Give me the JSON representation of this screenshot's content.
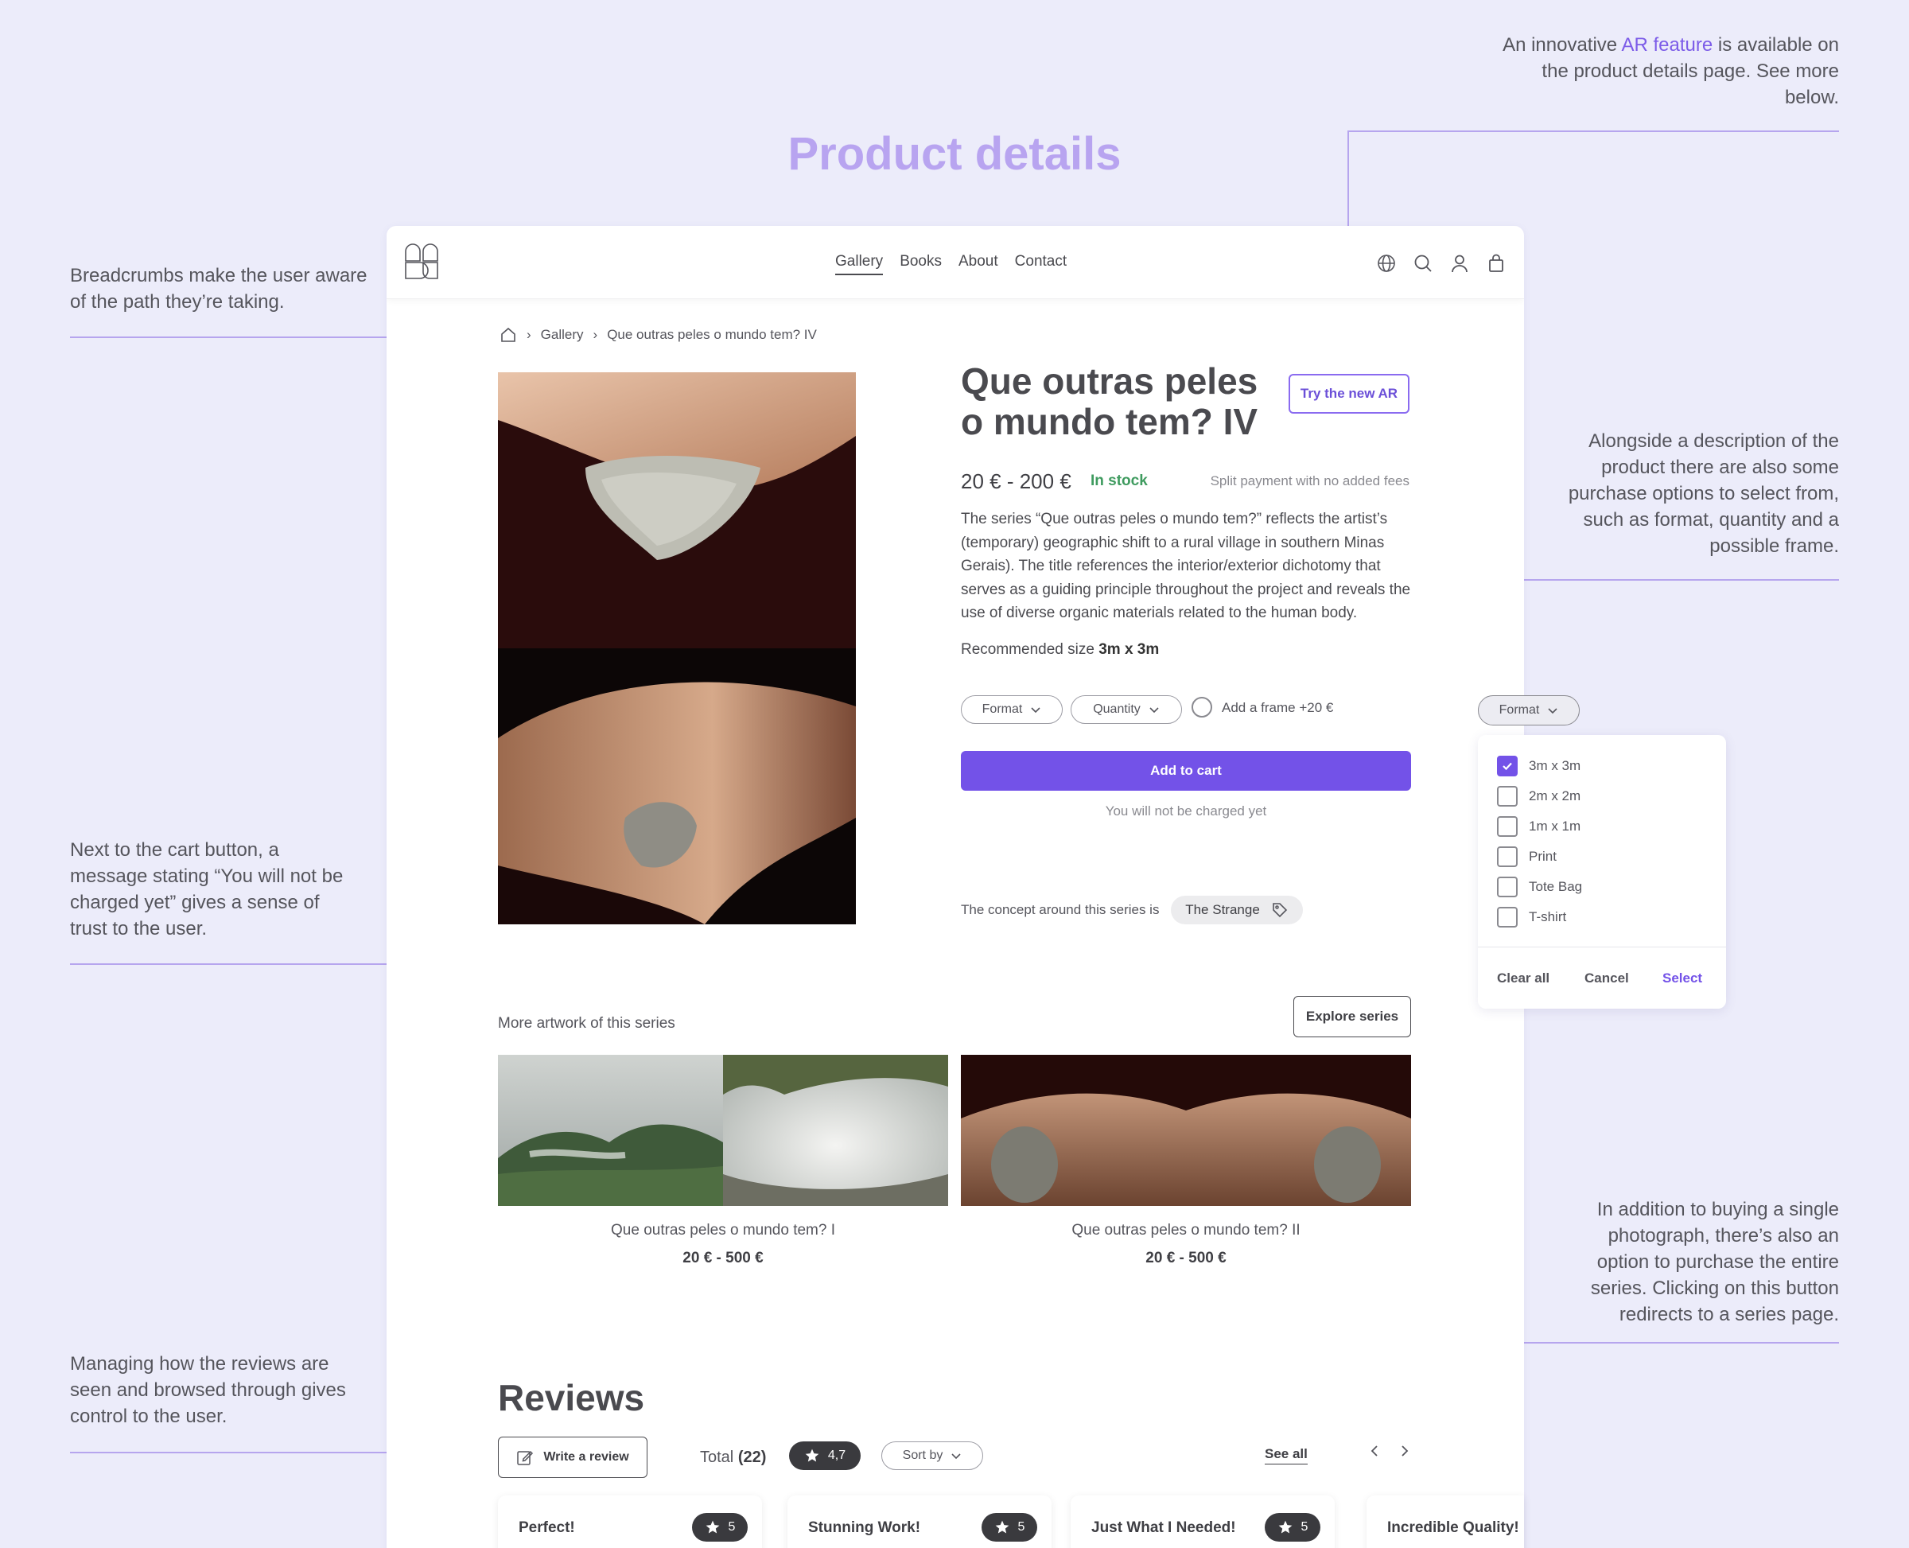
{
  "page_title": "Product details",
  "annotations": {
    "ar": {
      "before": "An innovative ",
      "accent": "AR feature",
      "after": " is available on the product details page. See more below."
    },
    "breadcrumbs": "Breadcrumbs make the user aware of the path they’re taking.",
    "description": "Alongside a  description of the product there are also some purchase options to select from, such as format, quantity and a possible frame.",
    "cart": "Next to the cart button, a message stating “You will not be charged yet” gives a sense of trust to the user.",
    "series": "In addition to buying a single photograph, there’s also an option to purchase the entire series. Clicking on this button redirects to a series page.",
    "reviews": "Managing how the reviews are seen and browsed through gives control to the user."
  },
  "nav": {
    "items": [
      "Gallery",
      "Books",
      "About",
      "Contact"
    ],
    "active": "Gallery"
  },
  "icons": [
    "globe-icon",
    "search-icon",
    "user-icon",
    "bag-icon"
  ],
  "breadcrumb": {
    "items": [
      "Gallery",
      "Que outras peles o mundo tem? IV"
    ]
  },
  "product": {
    "title": "Que outras peles o mundo tem? IV",
    "ar_button": "Try the new AR",
    "price": "20 € - 200 €",
    "stock": "In stock",
    "split": "Split payment with no added fees",
    "description": "The series “Que outras peles o mundo tem?” reflects the artist’s (temporary) geographic shift to a rural village in southern Minas Gerais). The title references the interior/exterior dichotomy that serves as a guiding principle throughout the project and reveals the use of diverse organic materials related to the human body.",
    "rec_label": "Recommended size ",
    "rec_value": "3m x 3m",
    "format_label": "Format",
    "quantity_label": "Quantity",
    "frame_label": "Add a frame +20 €",
    "cart_button": "Add to cart",
    "not_charged": "You will not be charged yet",
    "concept_label": "The concept around this series is",
    "concept_tag": "The Strange"
  },
  "series": {
    "heading": "More artwork of this series",
    "explore_button": "Explore series",
    "items": [
      {
        "title": "Que outras peles o mundo tem? I",
        "price": "20 € - 500 €"
      },
      {
        "title": "Que outras peles o mundo tem? II",
        "price": "20 € - 500 €"
      }
    ]
  },
  "reviews": {
    "heading": "Reviews",
    "write_button": "Write a review",
    "total_label": "Total ",
    "total_count": "(22)",
    "avg_rating": "4,7",
    "sort_label": "Sort by",
    "see_all": "See all",
    "cards": [
      {
        "title": "Perfect!",
        "rating": "5"
      },
      {
        "title": "Stunning Work!",
        "rating": "5"
      },
      {
        "title": "Just What I Needed!",
        "rating": "5"
      },
      {
        "title": "Incredible Quality!"
      }
    ]
  },
  "format_dropdown": {
    "label": "Format",
    "options": [
      {
        "label": "3m x 3m",
        "checked": true
      },
      {
        "label": "2m x 2m",
        "checked": false
      },
      {
        "label": "1m x 1m",
        "checked": false
      },
      {
        "label": "Print",
        "checked": false
      },
      {
        "label": "Tote Bag",
        "checked": false
      },
      {
        "label": "T-shirt",
        "checked": false
      }
    ],
    "clear_all": "Clear all",
    "cancel": "Cancel",
    "select": "Select"
  },
  "colors": {
    "accent": "#7352e8",
    "background": "#ececfa",
    "annotation_line": "#b6a5ee",
    "stock": "#3f9b5f"
  }
}
